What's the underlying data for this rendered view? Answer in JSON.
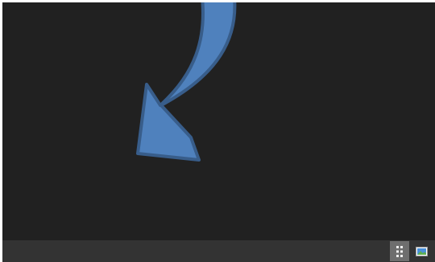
{
  "canvas": {
    "background": "#212121",
    "shape": {
      "icon": "curved-arrow",
      "fill": "#4f81bd",
      "stroke": "#385d8a"
    }
  },
  "statusbar": {
    "background": "#333333",
    "buttons": [
      {
        "icon": "slide-sorter-view-icon",
        "active": true
      },
      {
        "icon": "slide-view-icon",
        "active": false
      }
    ]
  }
}
